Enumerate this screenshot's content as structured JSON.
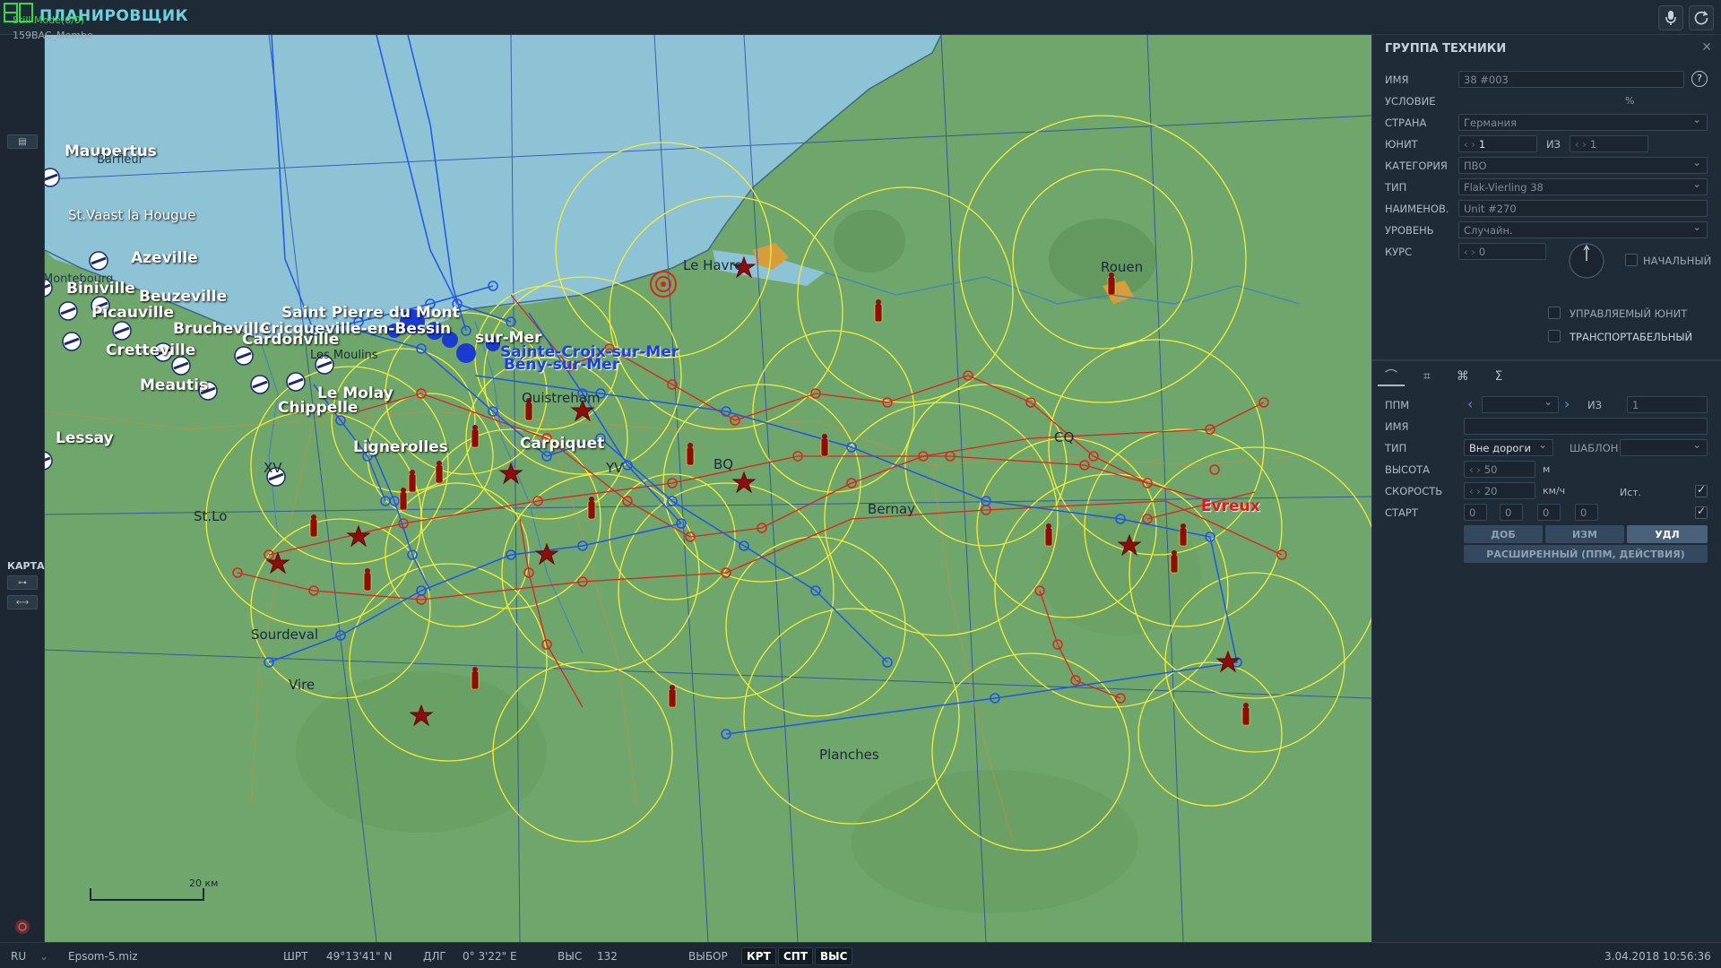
{
  "app": {
    "title": "ПЛАНИРОВЩИК",
    "debug_line": "Still Mode(0/0)",
    "mission_name": "159BAC_Membe"
  },
  "leftbar": {
    "map_label": "КАРТА"
  },
  "map": {
    "scale_label": "20 км",
    "towns": [
      {
        "id": "maupertus",
        "name": "Maupertus",
        "style": "white"
      },
      {
        "id": "barfleur",
        "name": "Barfleur",
        "style": "small"
      },
      {
        "id": "stvaast",
        "name": "St.Vaast la Hougue",
        "style": "white-small"
      },
      {
        "id": "azeville",
        "name": "Azeville",
        "style": "white"
      },
      {
        "id": "montebourg",
        "name": "Montebourg",
        "style": "small"
      },
      {
        "id": "biniville",
        "name": "Biniville",
        "style": "white"
      },
      {
        "id": "beuzeville",
        "name": "Beuzeville",
        "style": "white"
      },
      {
        "id": "picauville",
        "name": "Picauville",
        "style": "white"
      },
      {
        "id": "cretteville",
        "name": "Cretteville",
        "style": "white"
      },
      {
        "id": "meautis",
        "name": "Meautis",
        "style": "white"
      },
      {
        "id": "lessay",
        "name": "Lessay",
        "style": "white"
      },
      {
        "id": "brucheville",
        "name": "Brucheville",
        "style": "white"
      },
      {
        "id": "carpiquet_short",
        "name": "Cricqueville-en-Bessin",
        "style": "white"
      },
      {
        "id": "stpierre",
        "name": "Saint Pierre du Mont",
        "style": "white"
      },
      {
        "id": "cardonville",
        "name": "Cardonville",
        "style": "white"
      },
      {
        "id": "lemolay",
        "name": "Le Molay",
        "style": "white"
      },
      {
        "id": "chippelle",
        "name": "Chippelle",
        "style": "white"
      },
      {
        "id": "lignerolles",
        "name": "Lignerolles",
        "style": "white"
      },
      {
        "id": "bessin",
        "name": "sur-Mer",
        "style": "white"
      },
      {
        "id": "stcroix",
        "name": "Sainte-Croix-sur-Mer",
        "style": "blue"
      },
      {
        "id": "bazenville",
        "name": "Bény-sur-Mer",
        "style": "blue"
      },
      {
        "id": "ouistreham",
        "name": "Ouistreham",
        "style": "dark"
      },
      {
        "id": "lehavre",
        "name": "Le Havre",
        "style": "dark"
      },
      {
        "id": "rouen",
        "name": "Rouen",
        "style": "dark"
      },
      {
        "id": "bernay",
        "name": "Bernay",
        "style": "dark"
      },
      {
        "id": "evreux",
        "name": "Evreux",
        "style": "red"
      },
      {
        "id": "sourdeval",
        "name": "Sourdeval",
        "style": "dark"
      },
      {
        "id": "stlo",
        "name": "St.Lo",
        "style": "dark"
      },
      {
        "id": "vire",
        "name": "Vire",
        "style": "dark"
      },
      {
        "id": "planches",
        "name": "Planches",
        "style": "dark"
      },
      {
        "id": "lesmoulins",
        "name": "Les Moulins",
        "style": "dark"
      },
      {
        "id": "grid_xv",
        "name": "XV",
        "style": "dark"
      },
      {
        "id": "grid_yv",
        "name": "YV",
        "style": "dark"
      },
      {
        "id": "grid_bq",
        "name": "BQ",
        "style": "dark"
      },
      {
        "id": "grid_cq",
        "name": "CQ",
        "style": "dark"
      },
      {
        "id": "carpiquet",
        "name": "Carpiquet",
        "style": "white"
      }
    ],
    "colors": {
      "land": "#6fa66b",
      "sea": "#8ec3d6",
      "yellow_ring": "#f2ee3a",
      "red_route": "#d9261c",
      "blue_route": "#1f56e6",
      "unit_red": "#8c0d0d"
    }
  },
  "panel": {
    "title": "ГРУППА ТЕХНИКИ",
    "close_icon": "close-icon",
    "help_label": "?",
    "fields": {
      "name_label": "ИМЯ",
      "name_value": "38 #003",
      "condition_label": "УСЛОВИЕ",
      "condition_unit": "%",
      "country_label": "СТРАНА",
      "country_value": "Германия",
      "unit_label": "ЮНИТ",
      "unit_value": "1",
      "unit_of_label": "ИЗ",
      "unit_of_value": "1",
      "category_label": "КАТЕГОРИЯ",
      "category_value": "ПВО",
      "type_label": "ТИП",
      "type_value": "Flak-Vierling 38",
      "designation_label": "НАИМЕНОВ.",
      "designation_value": "Unit #270",
      "skill_label": "УРОВЕНЬ",
      "skill_value": "Случайн.",
      "heading_label": "КУРС",
      "heading_value": "0",
      "initial_label": "НАЧАЛЬНЫЙ",
      "controllable_label": "УПРАВЛЯЕМЫЙ ЮНИТ",
      "transportable_label": "ТРАНСПОРТАБЕЛЬНЫЙ"
    },
    "tabs": [
      "route-icon",
      "target-icon",
      "triggers-icon",
      "summary-icon"
    ],
    "tab_glyphs": [
      "⌒",
      "⌗",
      "⌘",
      "Σ"
    ],
    "waypoint": {
      "wpt_label": "ППМ",
      "wpt_of_label": "ИЗ",
      "wpt_of_value": "1",
      "name_label": "ИМЯ",
      "type_label": "ТИП",
      "type_value": "Вне дороги",
      "template_label": "ШАБЛОН",
      "altitude_label": "ВЫСОТА",
      "altitude_value": "50",
      "altitude_unit": "м",
      "speed_label": "СКОРОСТЬ",
      "speed_value": "20",
      "speed_unit": "км/ч",
      "eta_label": "Ист.",
      "start_label": "СТАРТ",
      "start_values": [
        "0",
        "0",
        "0",
        "0"
      ],
      "add_button": "ДОБ",
      "edit_button": "ИЗМ",
      "delete_button": "УДЛ",
      "advanced_button": "РАСШИРЕННЫЙ (ППМ, ДЕЙСТВИЯ)"
    }
  },
  "status": {
    "lang": "RU",
    "file": "Epsom-5.miz",
    "lat_label": "ШРТ",
    "lat_value": "49°13'41\" N",
    "lon_label": "ДЛГ",
    "lon_value": "0° 3'22\" E",
    "alt_label": "ВЫС",
    "alt_value": "132",
    "select_label": "ВЫБОР",
    "btn_krt": "КРТ",
    "btn_spt": "СПТ",
    "btn_vys": "ВЫС",
    "datetime": "3.04.2018 10:56:36"
  }
}
